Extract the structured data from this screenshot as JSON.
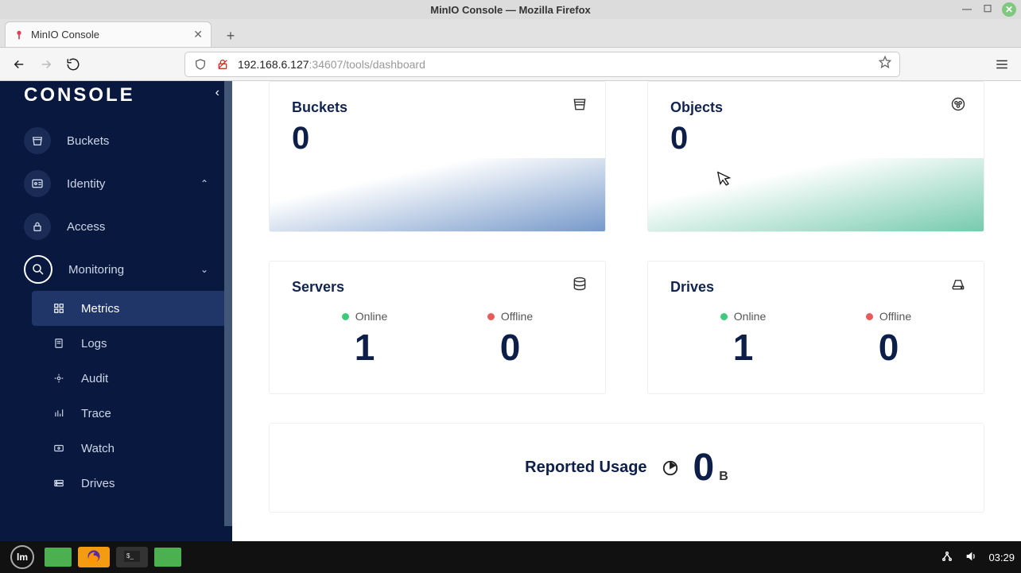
{
  "window": {
    "title": "MinIO Console — Mozilla Firefox"
  },
  "tab": {
    "title": "MinIO Console"
  },
  "url": {
    "host": "192.168.6.127",
    "path": ":34607/tools/dashboard"
  },
  "sidebar": {
    "brand": "CONSOLE",
    "items": [
      {
        "label": "Buckets",
        "icon": "bucket-icon"
      },
      {
        "label": "Identity",
        "icon": "id-icon",
        "expandable": true
      },
      {
        "label": "Access",
        "icon": "lock-icon"
      },
      {
        "label": "Monitoring",
        "icon": "magnify-icon",
        "expandable": true,
        "open": true,
        "children": [
          {
            "label": "Metrics",
            "icon": "grid-icon",
            "active": true
          },
          {
            "label": "Logs",
            "icon": "file-icon"
          },
          {
            "label": "Audit",
            "icon": "audit-icon"
          },
          {
            "label": "Trace",
            "icon": "trace-icon"
          },
          {
            "label": "Watch",
            "icon": "watch-icon"
          },
          {
            "label": "Drives",
            "icon": "drives-icon"
          }
        ]
      }
    ]
  },
  "cards": {
    "buckets": {
      "title": "Buckets",
      "value": "0"
    },
    "objects": {
      "title": "Objects",
      "value": "0"
    },
    "servers": {
      "title": "Servers",
      "online_label": "Online",
      "offline_label": "Offline",
      "online": "1",
      "offline": "0"
    },
    "drives": {
      "title": "Drives",
      "online_label": "Online",
      "offline_label": "Offline",
      "online": "1",
      "offline": "0"
    }
  },
  "usage": {
    "label": "Reported Usage",
    "value": "0",
    "unit": "B"
  },
  "taskbar": {
    "clock": "03:29"
  }
}
